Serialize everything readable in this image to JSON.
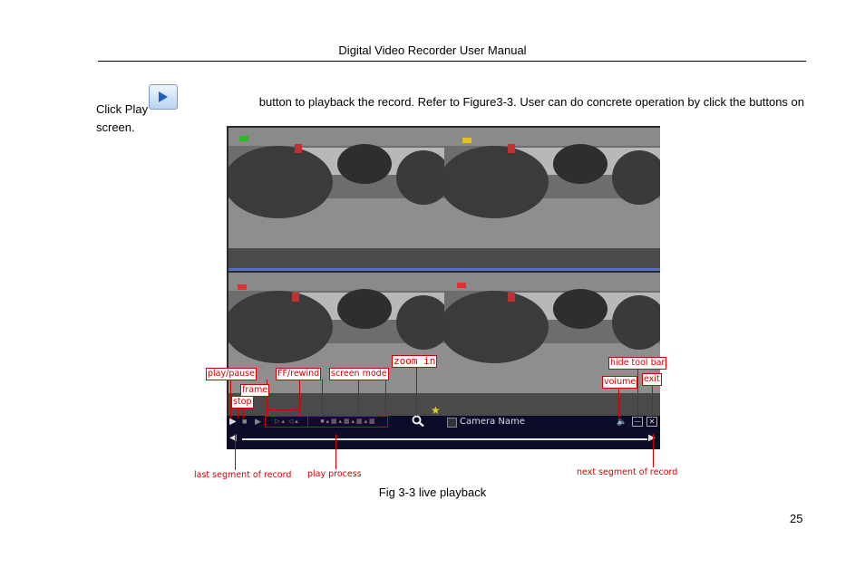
{
  "header": {
    "title": "Digital Video Recorder User Manual"
  },
  "paragraph": {
    "line1_part1": "Click Play",
    "line1_part2": "button to playback the record. Refer to Figure3-3. User can do concrete operation by click the buttons on",
    "line2": "screen."
  },
  "icons": {
    "inline_play": "play-button-icon"
  },
  "figure": {
    "toolbar": {
      "camera_name": "Camera Name"
    },
    "callouts": {
      "play_pause": "play/pause",
      "frame": "frame",
      "stop": "stop",
      "ff_rewind": "FF/rewind",
      "screen_mode": "screen mode",
      "zoom_in": "zoom in",
      "hide_tool_bar": "hide tool bar",
      "volume": "volume",
      "exit": "exit",
      "last_segment": "last segment of record",
      "play_process": "play process",
      "next_segment": "next segment of record"
    },
    "colors": {
      "callout": "#d00000",
      "toolbar": "#0b0b2a",
      "accent": "#3a5fcd"
    }
  },
  "caption": "Fig 3-3 live playback",
  "page_number": "25"
}
